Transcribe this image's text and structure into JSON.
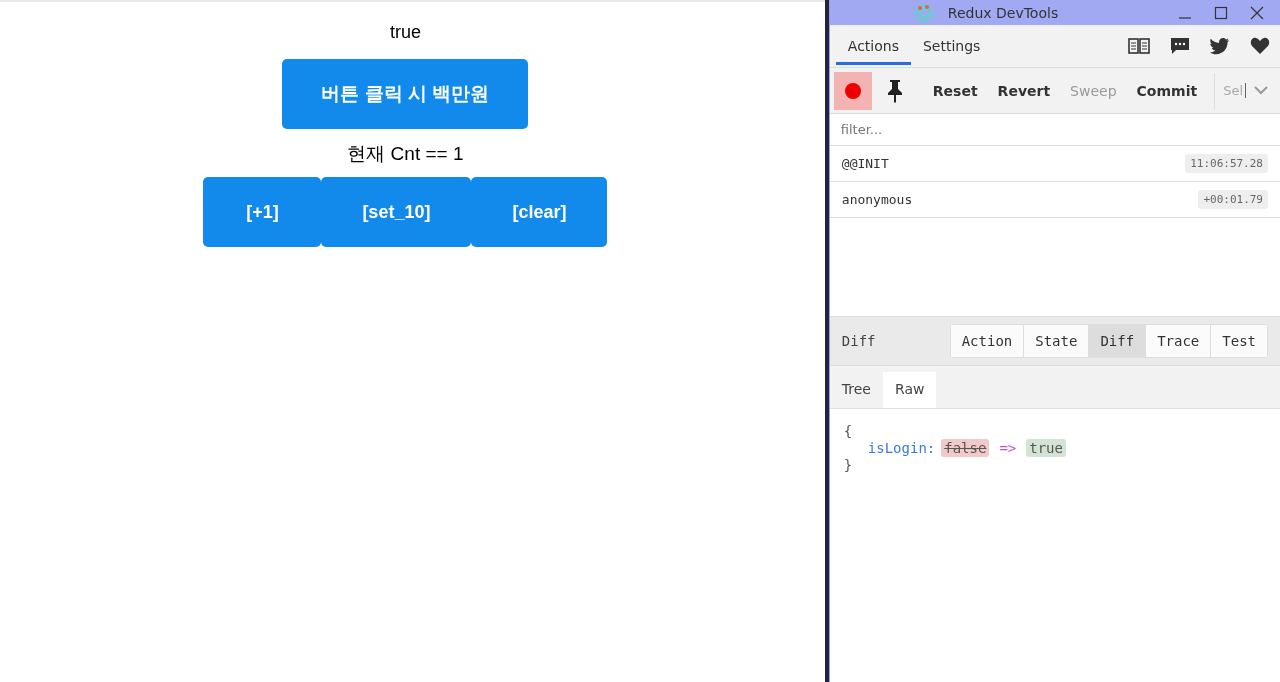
{
  "app": {
    "status_text": "true",
    "main_button": "버튼 클릭 시 백만원",
    "counter": "현재 Cnt == 1",
    "buttons": [
      "[+1]",
      "[set_10]",
      "[clear]"
    ]
  },
  "devtools": {
    "title": "Redux DevTools",
    "tabs": [
      {
        "label": "Actions",
        "selected": true
      },
      {
        "label": "Settings",
        "selected": false
      }
    ],
    "recording": true,
    "toolbar_buttons": [
      {
        "label": "Reset",
        "disabled": false
      },
      {
        "label": "Revert",
        "disabled": false
      },
      {
        "label": "Sweep",
        "disabled": true
      },
      {
        "label": "Commit",
        "disabled": false
      }
    ],
    "select": "Sel",
    "filter": {
      "placeholder": "filter..."
    },
    "actions": [
      {
        "name": "@@INIT",
        "time": "11:06:57.28"
      },
      {
        "name": "anonymous",
        "time": "+00:01.79"
      }
    ],
    "inspector": {
      "title": "Diff",
      "tabs": [
        {
          "label": "Action",
          "selected": false
        },
        {
          "label": "State",
          "selected": false
        },
        {
          "label": "Diff",
          "selected": true
        },
        {
          "label": "Trace",
          "selected": false
        },
        {
          "label": "Test",
          "selected": false
        }
      ],
      "subtabs": [
        {
          "label": "Tree",
          "selected": false
        },
        {
          "label": "Raw",
          "selected": true
        }
      ],
      "diff": {
        "open": "{",
        "key": "isLogin:",
        "old": "false",
        "arrow": "=>",
        "new": "true",
        "close": "}"
      }
    }
  }
}
